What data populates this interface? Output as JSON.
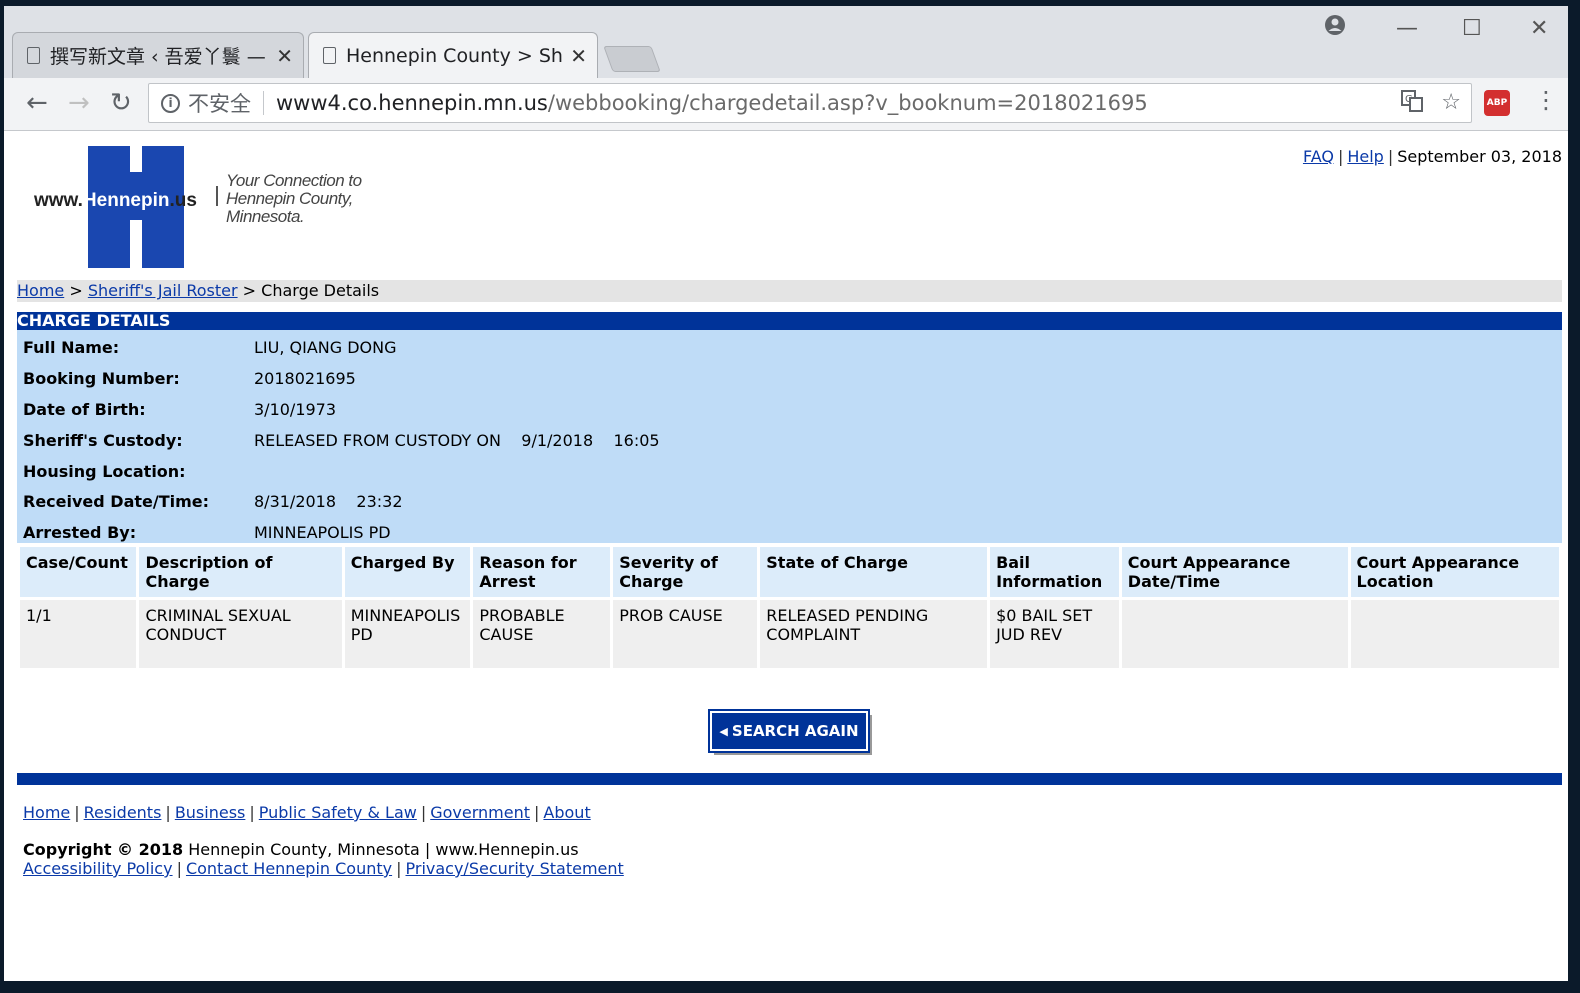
{
  "browser": {
    "tabs": [
      {
        "title": "撰写新文章 ‹ 吾爱丫鬟 —"
      },
      {
        "title": "Hennepin County > She"
      }
    ],
    "url": {
      "security_label": "不安全",
      "host": "www4.co.hennepin.mn.us",
      "path": "/webbooking/chargedetail.asp?v_booknum=2018021695"
    },
    "icons": {
      "back": "arrow-left-icon",
      "forward": "arrow-right-icon",
      "reload": "reload-icon",
      "translate": "translate-icon",
      "bookmark": "star-icon",
      "adblock": "ABP",
      "menu": "kebab-icon"
    }
  },
  "site": {
    "logo": {
      "prefix": "www.",
      "name": "Hennepin",
      "suffix": ".us",
      "tagline_1": "Your Connection to",
      "tagline_2": "Hennepin County,",
      "tagline_3": "Minnesota."
    },
    "top_links": {
      "faq": "FAQ",
      "help": "Help",
      "date": "September 03, 2018"
    },
    "breadcrumb": {
      "home": "Home",
      "roster": "Sheriff's Jail Roster",
      "current": "Charge Details"
    },
    "section_title": "CHARGE DETAILS"
  },
  "details": [
    {
      "label": "Full Name:",
      "value": "LIU, QIANG  DONG"
    },
    {
      "label": "Booking Number:",
      "value": "2018021695"
    },
    {
      "label": "Date of Birth:",
      "value": "3/10/1973"
    },
    {
      "label": "Sheriff's Custody:",
      "value": "RELEASED FROM CUSTODY ON    9/1/2018    16:05"
    },
    {
      "label": "Housing Location:",
      "value": ""
    },
    {
      "label": "Received Date/Time:",
      "value": "8/31/2018    23:32"
    },
    {
      "label": "Arrested By:",
      "value": "MINNEAPOLIS PD"
    }
  ],
  "charges": {
    "headers": [
      "Case/Count",
      "Description of Charge",
      "Charged By",
      "Reason for Arrest",
      "Severity of Charge",
      "State of Charge",
      "Bail Information",
      "Court Appearance Date/Time",
      "Court Appearance Location"
    ],
    "rows": [
      [
        "1/1",
        "CRIMINAL SEXUAL CONDUCT",
        "MINNEAPOLIS PD",
        "PROBABLE CAUSE",
        "PROB CAUSE",
        "RELEASED PENDING COMPLAINT",
        "$0 BAIL SET JUD REV",
        "",
        ""
      ]
    ]
  },
  "search_again": "SEARCH AGAIN",
  "footer": {
    "links": [
      "Home",
      "Residents",
      "Business",
      "Public Safety & Law",
      "Government",
      "About"
    ],
    "copyright_bold": "Copyright © 2018",
    "copyright_rest": "Hennepin County, Minnesota | www.Hennepin.us",
    "policy_links": [
      "Accessibility Policy",
      "Contact Hennepin County",
      "Privacy/Security Statement"
    ]
  },
  "colors": {
    "brand_blue": "#003399",
    "details_bg": "#bfdcf7",
    "link": "#0b3aa8"
  }
}
